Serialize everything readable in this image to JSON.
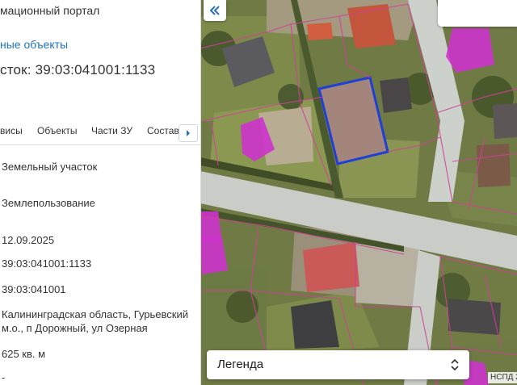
{
  "panel": {
    "portal_title": "мационный портал",
    "objects_link": "ные объекты",
    "plot_title": "сток: 39:03:041001:1133",
    "tabs": [
      "висы",
      "Объекты",
      "Части ЗУ",
      "Состав"
    ],
    "rows": [
      "Земельный участок",
      "Землепользование",
      "12.09.2025",
      "39:03:041001:1133",
      "39:03:041001",
      "Калининградская область, Гурьевский м.о., п Дорожный, ул Озерная",
      "625 кв. м",
      "-"
    ]
  },
  "map": {
    "legend_label": "Легенда",
    "attribution": "НСПД 2",
    "selected_parcel_color": "#1f3fd6",
    "parcel_border_color": "#d0409a",
    "building_color": "#cc33cc"
  },
  "icons": {
    "collapse": "double-chevron-left-icon",
    "tabs_next": "chevron-right-icon",
    "legend_toggle": "up-down-chevron-icon"
  }
}
